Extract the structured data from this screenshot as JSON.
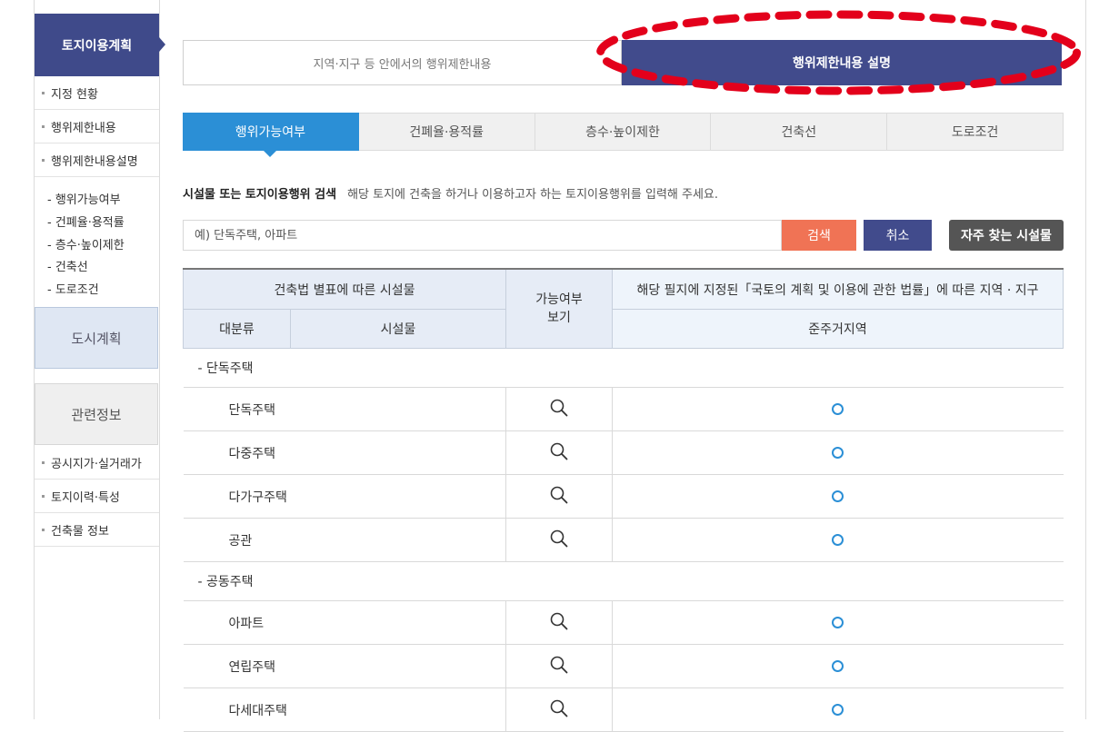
{
  "sidebar": {
    "header": "토지이용계획",
    "items_top": [
      "지정 현황",
      "행위제한내용",
      "행위제한내용설명"
    ],
    "sub_items": [
      "- 행위가능여부",
      "- 건폐율·용적률",
      "- 층수·높이제한",
      "- 건축선",
      "- 도로조건"
    ],
    "box1": "도시계획",
    "box2": "관련정보",
    "items_bottom": [
      "공시지가·실거래가",
      "토지이력·특성",
      "건축물 정보"
    ]
  },
  "top_tabs": [
    "지역·지구 등 안에서의 행위제한내용",
    "행위제한내용 설명"
  ],
  "sub_tabs": [
    "행위가능여부",
    "건폐율·용적률",
    "층수·높이제한",
    "건축선",
    "도로조건"
  ],
  "search": {
    "title": "시설물 또는 토지이용행위 검색",
    "description": "해당 토지에 건축을 하거나 이용하고자 하는 토지이용행위를 입력해 주세요.",
    "placeholder": "예) 단독주택, 아파트",
    "search_button": "검색",
    "cancel_button": "취소",
    "frequent_button": "자주 찾는 시설물"
  },
  "table": {
    "header_facility": "건축법 별표에 따른 시설물",
    "header_possible": "가능여부\n보기",
    "header_zone_title": "해당 필지에 지정된「국토의 계획 및 이용에 관한 법률」에 따른 지역 · 지구",
    "subheader_category": "대분류",
    "subheader_facility": "시설물",
    "subheader_zone": "준주거지역",
    "groups": [
      {
        "label": "- 단독주택",
        "rows": [
          "단독주택",
          "다중주택",
          "다가구주택",
          "공관"
        ]
      },
      {
        "label": "- 공동주택",
        "rows": [
          "아파트",
          "연립주택",
          "다세대주택"
        ]
      }
    ]
  },
  "colors": {
    "primary": "#414b8c",
    "accent": "#2b8fd6",
    "search": "#f07355",
    "highlight": "#e3001b"
  }
}
